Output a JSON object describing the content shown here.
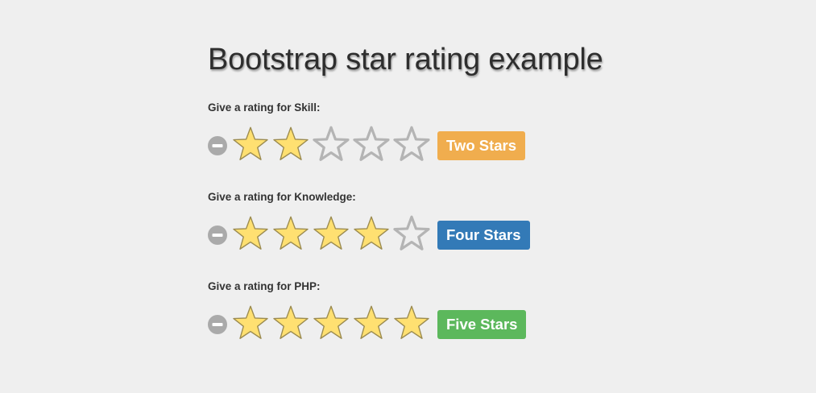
{
  "page": {
    "title": "Bootstrap star rating example"
  },
  "colors": {
    "background": "#efefef",
    "star_filled": "#ffe071",
    "star_filled_stroke": "#9b8b50",
    "star_empty_stroke": "#b4b4b4",
    "clear_icon": "#aaaaaa"
  },
  "icons": {
    "clear": "minus-circle-icon",
    "star_filled": "star-filled-icon",
    "star_empty": "star-outline-icon"
  },
  "ratings": [
    {
      "label": "Give a rating for Skill:",
      "value": 2,
      "max": 5,
      "caption": "Two Stars",
      "caption_color": "#f0ad4e"
    },
    {
      "label": "Give a rating for Knowledge:",
      "value": 4,
      "max": 5,
      "caption": "Four Stars",
      "caption_color": "#337ab7"
    },
    {
      "label": "Give a rating for PHP:",
      "value": 5,
      "max": 5,
      "caption": "Five Stars",
      "caption_color": "#5cb85c"
    }
  ]
}
